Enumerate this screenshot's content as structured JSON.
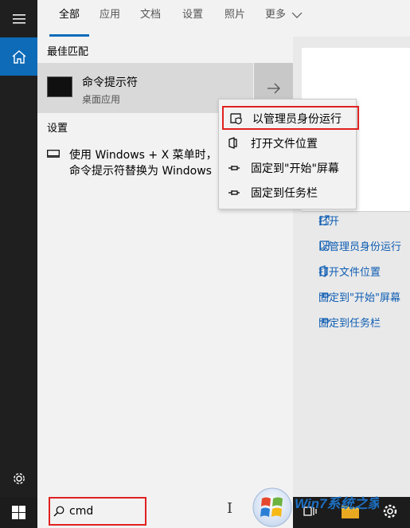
{
  "tabs": [
    {
      "label": "全部"
    },
    {
      "label": "应用"
    },
    {
      "label": "文档"
    },
    {
      "label": "设置"
    },
    {
      "label": "照片"
    },
    {
      "label": "更多"
    }
  ],
  "best_match": {
    "section_title": "最佳匹配",
    "app_name": "命令提示符",
    "app_type": "桌面应用"
  },
  "settings_section": {
    "title": "设置",
    "item_line1": "使用 Windows + X 菜单时，",
    "item_line2": "命令提示符替换为 Windows"
  },
  "context_menu": [
    {
      "label": "以管理员身份运行",
      "icon": "shield-icon"
    },
    {
      "label": "打开文件位置",
      "icon": "file-location-icon"
    },
    {
      "label": "固定到\"开始\"屏幕",
      "icon": "pin-icon"
    },
    {
      "label": "固定到任务栏",
      "icon": "pin-icon"
    }
  ],
  "preview_actions": [
    {
      "label": "打开",
      "icon": "open-icon"
    },
    {
      "label": "以管理员身份运行",
      "icon": "shield-icon"
    },
    {
      "label": "打开文件位置",
      "icon": "file-location-icon"
    },
    {
      "label": "固定到\"开始\"屏幕",
      "icon": "pin-icon"
    },
    {
      "label": "固定到任务栏",
      "icon": "pin-icon"
    }
  ],
  "search": {
    "value": "cmd"
  },
  "watermark": {
    "text": "Win7系统之家"
  },
  "colors": {
    "accent": "#0e6bb8",
    "highlight_border": "#e02020",
    "link": "#0e5db3"
  }
}
